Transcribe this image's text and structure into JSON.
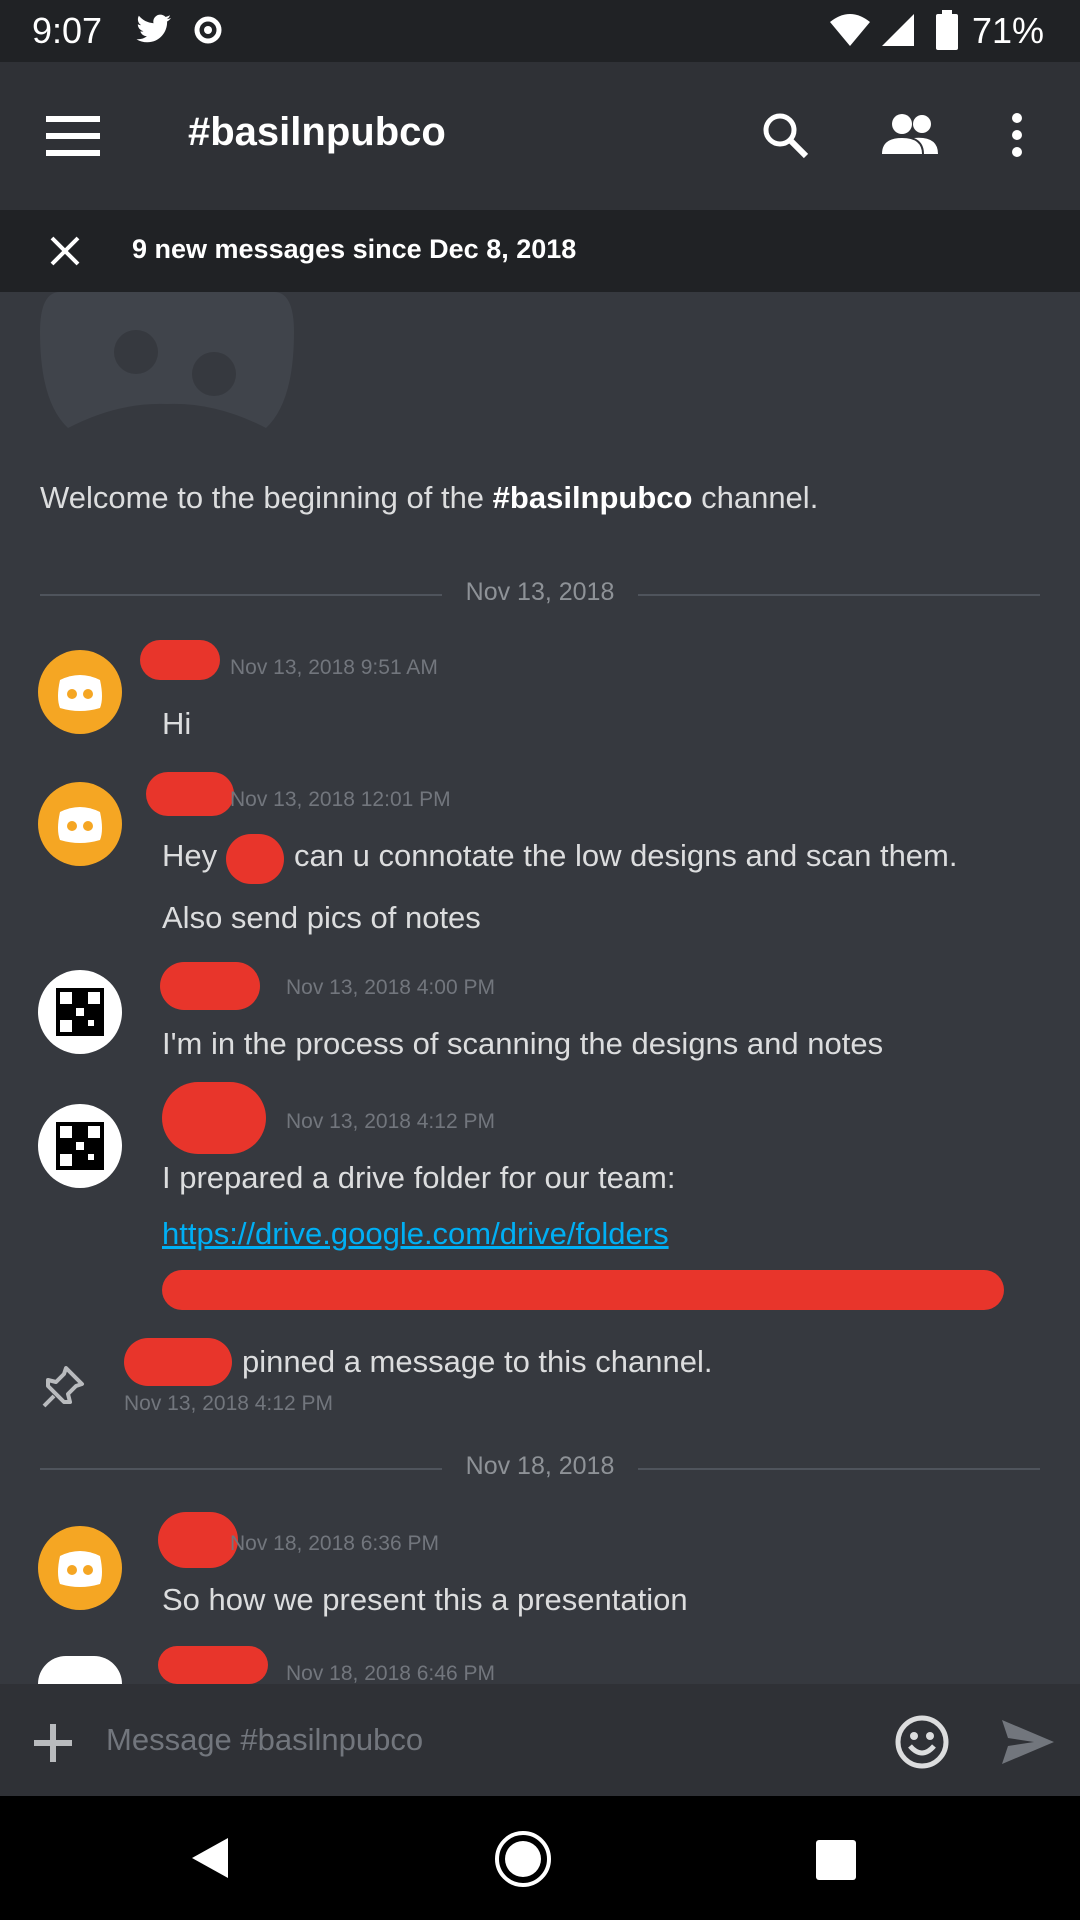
{
  "status_bar": {
    "time": "9:07",
    "battery": "71%"
  },
  "header": {
    "title": "#basilnpubco"
  },
  "new_messages": {
    "text": "9 new messages since Dec 8, 2018"
  },
  "welcome": {
    "prefix": "Welcome to the beginning of the ",
    "channel": "#basilnpubco",
    "suffix": " channel."
  },
  "dividers": [
    "Nov 13, 2018",
    "Nov 18, 2018"
  ],
  "messages": [
    {
      "time": "Nov 13, 2018 9:51 AM",
      "lines": [
        "Hi"
      ]
    },
    {
      "time": "Nov 13, 2018 12:01 PM",
      "lines": [
        "Hey",
        "can u connotate the low designs and scan them.",
        "Also send pics of notes"
      ]
    },
    {
      "time": "Nov 13, 2018 4:00 PM",
      "lines": [
        "I'm in the process of scanning the designs and notes"
      ]
    },
    {
      "time": "Nov 13, 2018 4:12 PM",
      "lines": [
        "I prepared a drive folder for our team:"
      ],
      "link": "https://drive.google.com/drive/folders"
    },
    {
      "time": "Nov 18, 2018 6:36 PM",
      "lines": [
        "So how we present this a presentation"
      ]
    },
    {
      "time": "Nov 18, 2018 6:46 PM",
      "lines": []
    }
  ],
  "pinned": {
    "text": "pinned a message to this channel.",
    "time": "Nov 13, 2018 4:12 PM"
  },
  "composer": {
    "placeholder": "Message #basilnpubco"
  }
}
